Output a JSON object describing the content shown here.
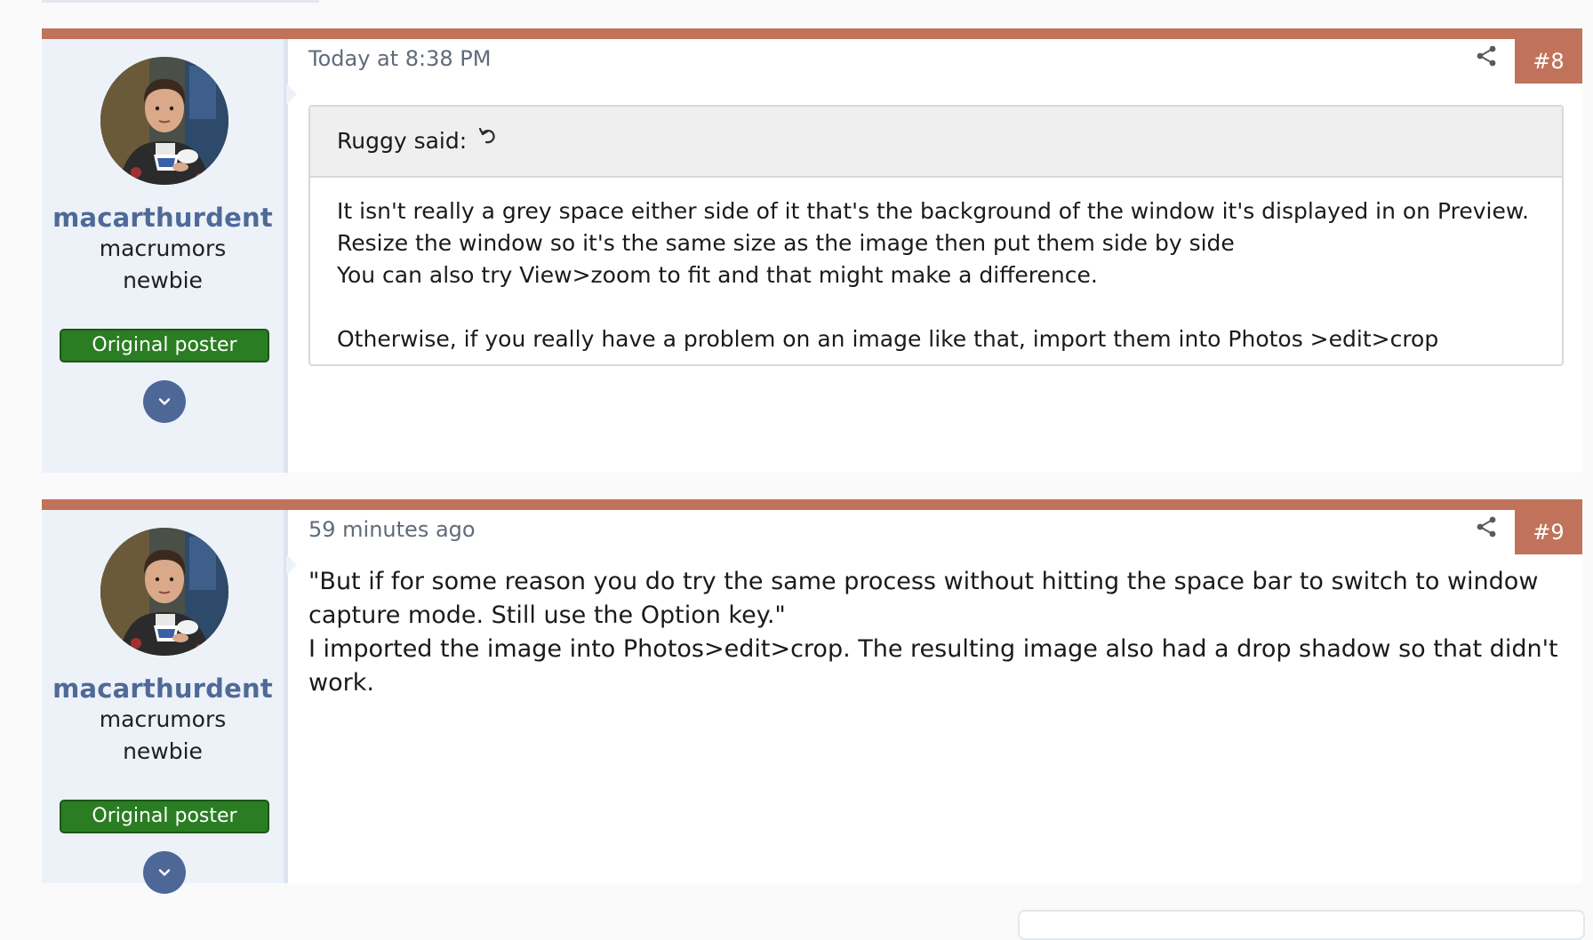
{
  "posts": [
    {
      "username": "macarthurdent",
      "user_title_line1": "macrumors",
      "user_title_line2": "newbie",
      "badge": "Original poster",
      "timestamp": "Today at 8:38 PM",
      "post_number": "#8",
      "quote": {
        "author_label": "Ruggy said:",
        "lines": [
          "It isn't really a grey space either side of it that's the background of the window it's displayed in on Preview.",
          "Resize the window so it's the same size as the image then put them side by side",
          "You can also try View>zoom to fit and that might make a difference.",
          "Otherwise, if you really have a problem on an image like that, import them into Photos >edit>crop"
        ]
      }
    },
    {
      "username": "macarthurdent",
      "user_title_line1": "macrumors",
      "user_title_line2": "newbie",
      "badge": "Original poster",
      "timestamp": "59 minutes ago",
      "post_number": "#9",
      "body": [
        "\"But if for some reason you do try the same process without hitting the space bar to switch to window capture mode. Still use the Option key.\"",
        "I imported the image into Photos>edit>crop. The resulting image also had a drop shadow so that didn't work."
      ]
    }
  ],
  "icons": {
    "share": "share-icon",
    "expand": "chevron-down-icon",
    "quote_jump": "return-arrow-icon"
  },
  "colors": {
    "accent": "#c0735a",
    "username": "#4f6a96",
    "badge": "#2a7d22",
    "user_panel": "#edf2f9"
  }
}
